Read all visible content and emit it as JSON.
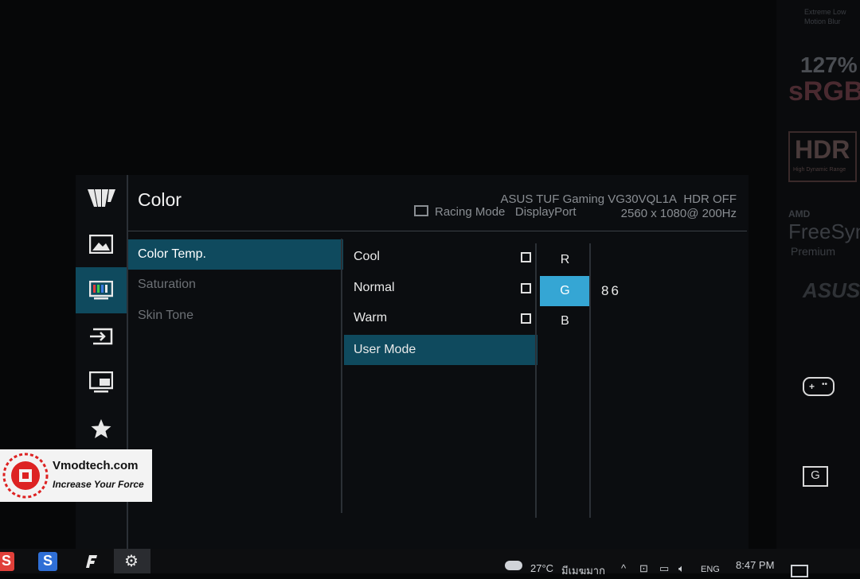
{
  "osd": {
    "title": "Color",
    "model": "ASUS TUF Gaming VG30VQL1A",
    "hdr": "HDR OFF",
    "mode": "Racing Mode",
    "input": "DisplayPort",
    "resolution": "2560 x 1080@ 200Hz",
    "menu": [
      "Color Temp.",
      "Saturation",
      "Skin Tone"
    ],
    "submenu": [
      "Cool",
      "Normal",
      "Warm",
      "User Mode"
    ],
    "channels": [
      "R",
      "G",
      "B"
    ],
    "g_value": "86",
    "accent": "#35a6d4",
    "selected_bg": "#0f4a5e"
  },
  "rail_icons": [
    "tuf-logo-icon",
    "image-icon",
    "color-icon",
    "input-icon",
    "pip-icon",
    "favorite-icon"
  ],
  "bezel": {
    "elmb_line1": "Extreme Low",
    "elmb_line2": "Motion Blur",
    "srgb_pct": "127%",
    "srgb": "sRGB",
    "hdr": "HDR",
    "hdr_sub": "High Dynamic Range",
    "amd": "AMD",
    "freesync": "FreeSync",
    "premium": "Premium",
    "asus": "ASUS",
    "g_key": "G"
  },
  "watermark": {
    "site": "Vmodtech.com",
    "slogan": "Increase Your Force"
  },
  "taskbar": {
    "weather": "27°C",
    "weather_desc": "มีเมฆมาก",
    "lang": "ENG",
    "time": "8:47 PM"
  }
}
